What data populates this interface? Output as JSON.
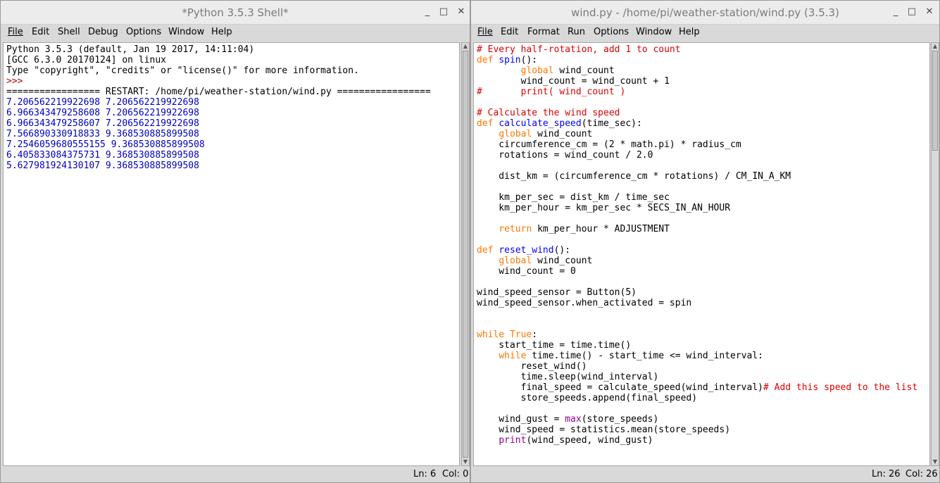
{
  "shell": {
    "title": "*Python 3.5.3 Shell*",
    "menu": [
      "File",
      "Edit",
      "Shell",
      "Debug",
      "Options",
      "Window",
      "Help"
    ],
    "banner": [
      "Python 3.5.3 (default, Jan 19 2017, 14:11:04)",
      "[GCC 6.3.0 20170124] on linux",
      "Type \"copyright\", \"credits\" or \"license()\" for more information."
    ],
    "prompt": ">>>",
    "restart_line": "================= RESTART: /home/pi/weather-station/wind.py =================",
    "output": [
      "7.206562219922698 7.206562219922698",
      "6.966343479258608 7.206562219922698",
      "6.966343479258607 7.206562219922698",
      "7.566890330918833 9.368530885899508",
      "7.2546059680555155 9.368530885899508",
      "6.405833084375731 9.368530885899508",
      "5.627981924130107 9.368530885899508"
    ],
    "status_ln": "Ln: 6",
    "status_col": "Col: 0"
  },
  "editor": {
    "title": "wind.py - /home/pi/weather-station/wind.py (3.5.3)",
    "menu": [
      "File",
      "Edit",
      "Format",
      "Run",
      "Options",
      "Window",
      "Help"
    ],
    "code": [
      "# Every half-rotation, add 1 to count",
      "def spin():",
      "        global wind_count",
      "        wind_count = wind_count + 1",
      "#       print( wind_count )",
      "",
      "# Calculate the wind speed",
      "def calculate_speed(time_sec):",
      "    global wind_count",
      "    circumference_cm = (2 * math.pi) * radius_cm",
      "    rotations = wind_count / 2.0",
      "",
      "    dist_km = (circumference_cm * rotations) / CM_IN_A_KM",
      "",
      "    km_per_sec = dist_km / time_sec",
      "    km_per_hour = km_per_sec * SECS_IN_AN_HOUR",
      "",
      "    return km_per_hour * ADJUSTMENT",
      "",
      "def reset_wind():",
      "    global wind_count",
      "    wind_count = 0",
      "",
      "wind_speed_sensor = Button(5)",
      "wind_speed_sensor.when_activated = spin",
      "",
      "",
      "while True:",
      "    start_time = time.time()",
      "    while time.time() - start_time <= wind_interval:",
      "        reset_wind()",
      "        time.sleep(wind_interval)",
      "        final_speed = calculate_speed(wind_interval)# Add this speed to the list",
      "        store_speeds.append(final_speed)",
      "",
      "    wind_gust = max(store_speeds)",
      "    wind_speed = statistics.mean(store_speeds)",
      "    print(wind_speed, wind_gust)"
    ],
    "status_ln": "Ln: 26",
    "status_col": "Col: 26"
  },
  "window_buttons": {
    "minimize": "_",
    "maximize": "□",
    "close": "✕"
  },
  "colors": {
    "keyword": "#ff7700",
    "definition": "#0000ff",
    "builtin": "#900090",
    "comment": "#dd0000",
    "stdout": "#0000c0"
  }
}
